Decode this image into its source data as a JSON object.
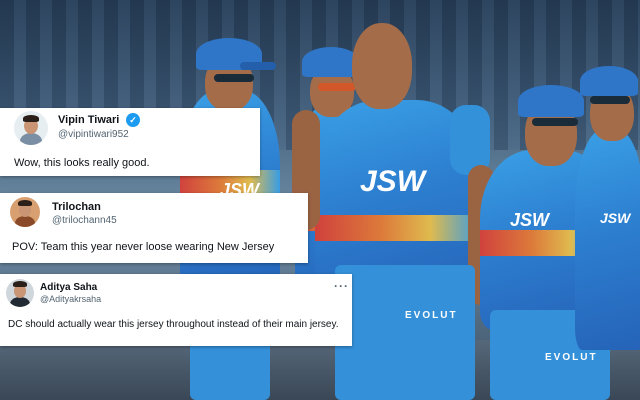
{
  "photo": {
    "jersey_logos": [
      "JSW",
      "JSW",
      "JSW",
      "JSW"
    ],
    "shorts_brand": [
      "EVOLUT",
      "EVOLUT"
    ],
    "colors": {
      "jersey": "#2d7fd0",
      "stripe": "#e23b2d",
      "cap": "#2f76c9"
    }
  },
  "tweets": [
    {
      "name": "Vipin Tiwari",
      "handle": "@vipintiwari952",
      "text": "Wow, this looks really good.",
      "verified": true,
      "verified_glyph": "✓"
    },
    {
      "name": "Trilochan",
      "handle": "@trilochann45",
      "text": "POV: Team this year never loose wearing New Jersey"
    },
    {
      "name": "Aditya Saha",
      "handle": "@Adityakrsaha",
      "text": "DC should actually wear this jersey throughout instead of their main jersey.",
      "more_glyph": "···"
    }
  ]
}
